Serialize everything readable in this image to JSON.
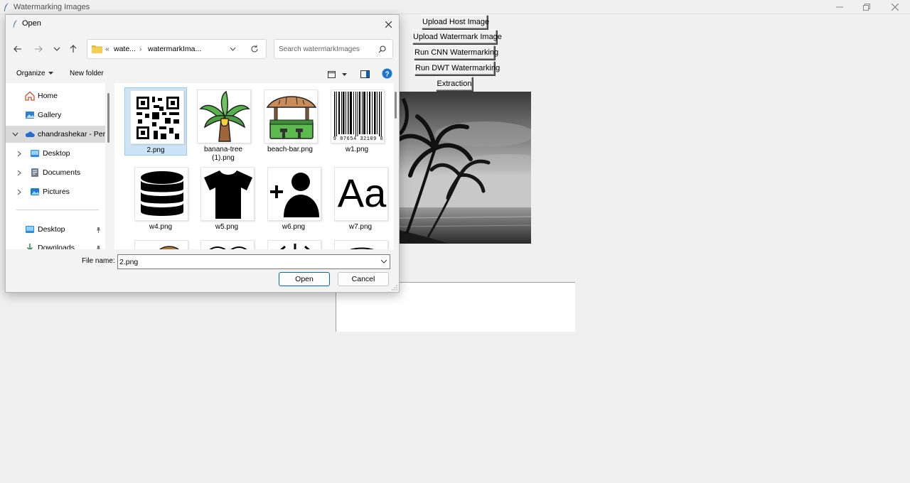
{
  "app": {
    "title": "Watermarking Images",
    "buttons": {
      "upload_host": "Upload Host Image",
      "upload_watermark": "Upload Watermark Image",
      "run_cnn": "Run CNN Watermarking",
      "run_dwt": "Run DWT Watermarking",
      "extraction": "Extraction"
    }
  },
  "dialog": {
    "title": "Open",
    "breadcrumb": {
      "overflow": "«",
      "parent": "wate...",
      "separator": "›",
      "current": "watermarkIma..."
    },
    "search": {
      "placeholder": "Search watermarkImages"
    },
    "commands": {
      "organize": "Organize",
      "new_folder": "New folder"
    },
    "nav_items": [
      {
        "label": "Home",
        "icon": "home-icon"
      },
      {
        "label": "Gallery",
        "icon": "gallery-icon"
      },
      {
        "label": "chandrashekar - Pers",
        "icon": "onedrive-cloud-icon"
      },
      {
        "label": "Desktop",
        "icon": "desktop-folder-icon"
      },
      {
        "label": "Documents",
        "icon": "documents-folder-icon"
      },
      {
        "label": "Pictures",
        "icon": "pictures-folder-icon"
      },
      {
        "label": "Desktop",
        "icon": "desktop-folder-icon"
      },
      {
        "label": "Downloads",
        "icon": "downloads-folder-icon"
      }
    ],
    "files": [
      {
        "name": "2.png",
        "thumb": "qr-code"
      },
      {
        "name": "banana-tree (1).png",
        "thumb": "palm-tree"
      },
      {
        "name": "beach-bar.png",
        "thumb": "beach-hut"
      },
      {
        "name": "w1.png",
        "thumb": "barcode"
      },
      {
        "name": "w4.png",
        "thumb": "database-stack"
      },
      {
        "name": "w5.png",
        "thumb": "t-shirt"
      },
      {
        "name": "w6.png",
        "thumb": "add-user"
      },
      {
        "name": "w7.png",
        "thumb": "font-aa"
      }
    ],
    "barcode_digits": "9 87654 32109 8",
    "font_sample": "Aa",
    "filename": {
      "label": "File name:",
      "value": "2.png"
    },
    "buttons": {
      "open": "Open",
      "cancel": "Cancel"
    }
  },
  "colors": {
    "accent": "#0067c0",
    "selection": "#cce4f7",
    "selection_border": "#99c9ef",
    "folder": "#f4c542"
  }
}
